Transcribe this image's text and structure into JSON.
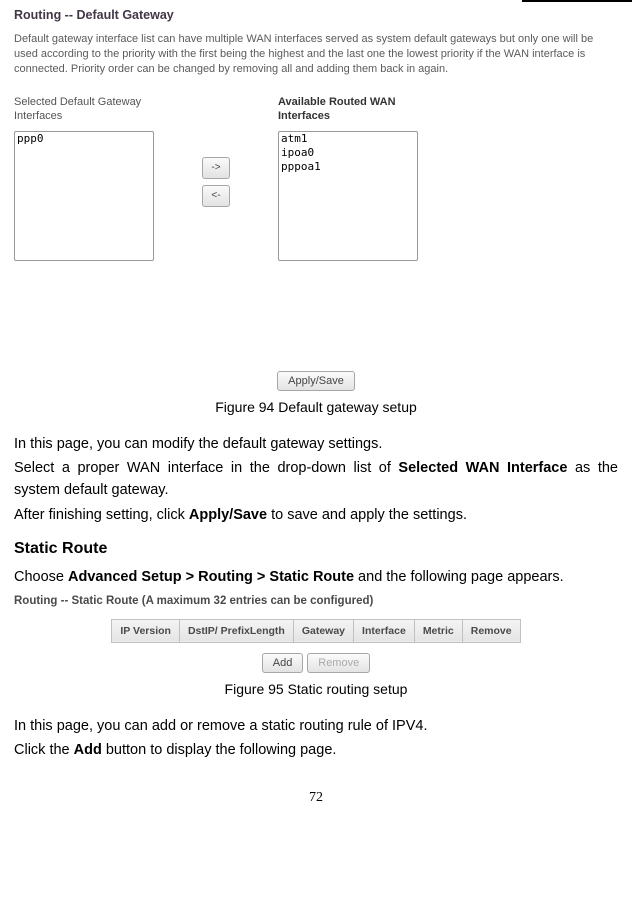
{
  "gateway": {
    "panel_title": "Routing -- Default Gateway",
    "description": "Default gateway interface list can have multiple WAN interfaces served as system default gateways but only one will be used according to the priority with the first being the highest and the last one the lowest priority if the WAN interface is connected. Priority order can be changed by removing all and adding them back in again.",
    "selected_label": "Selected Default Gateway Interfaces",
    "available_label": "Available Routed WAN Interfaces",
    "selected_items": [
      "ppp0"
    ],
    "available_items": [
      "atm1",
      "ipoa0",
      "pppoa1"
    ],
    "arrow_right": "->",
    "arrow_left": "<-",
    "apply_label": "Apply/Save"
  },
  "figure94_caption": "Figure 94 Default gateway setup",
  "para1": "In this page, you can modify the default gateway settings.",
  "para2_a": "Select a proper WAN interface in the drop-down list of ",
  "para2_b": "Selected WAN Interface",
  "para2_c": " as the system default gateway.",
  "para3_a": "After finishing setting, click ",
  "para3_b": "Apply/Save",
  "para3_c": " to save and apply the settings.",
  "static_heading": "Static Route",
  "para4_a": "Choose ",
  "para4_b": "Advanced Setup > Routing > Static Route",
  "para4_c": " and the following page appears.",
  "static_panel_title": "Routing -- Static Route (A maximum 32 entries can be configured)",
  "static_table": {
    "headers": [
      "IP Version",
      "DstIP/ PrefixLength",
      "Gateway",
      "Interface",
      "Metric",
      "Remove"
    ],
    "add_label": "Add",
    "remove_label": "Remove"
  },
  "figure95_caption": "Figure 95 Static routing setup",
  "para5": "In this page, you can add or remove a static routing rule of IPV4.",
  "para6_a": "Click the ",
  "para6_b": "Add",
  "para6_c": " button to display the following page.",
  "page_number": "72"
}
